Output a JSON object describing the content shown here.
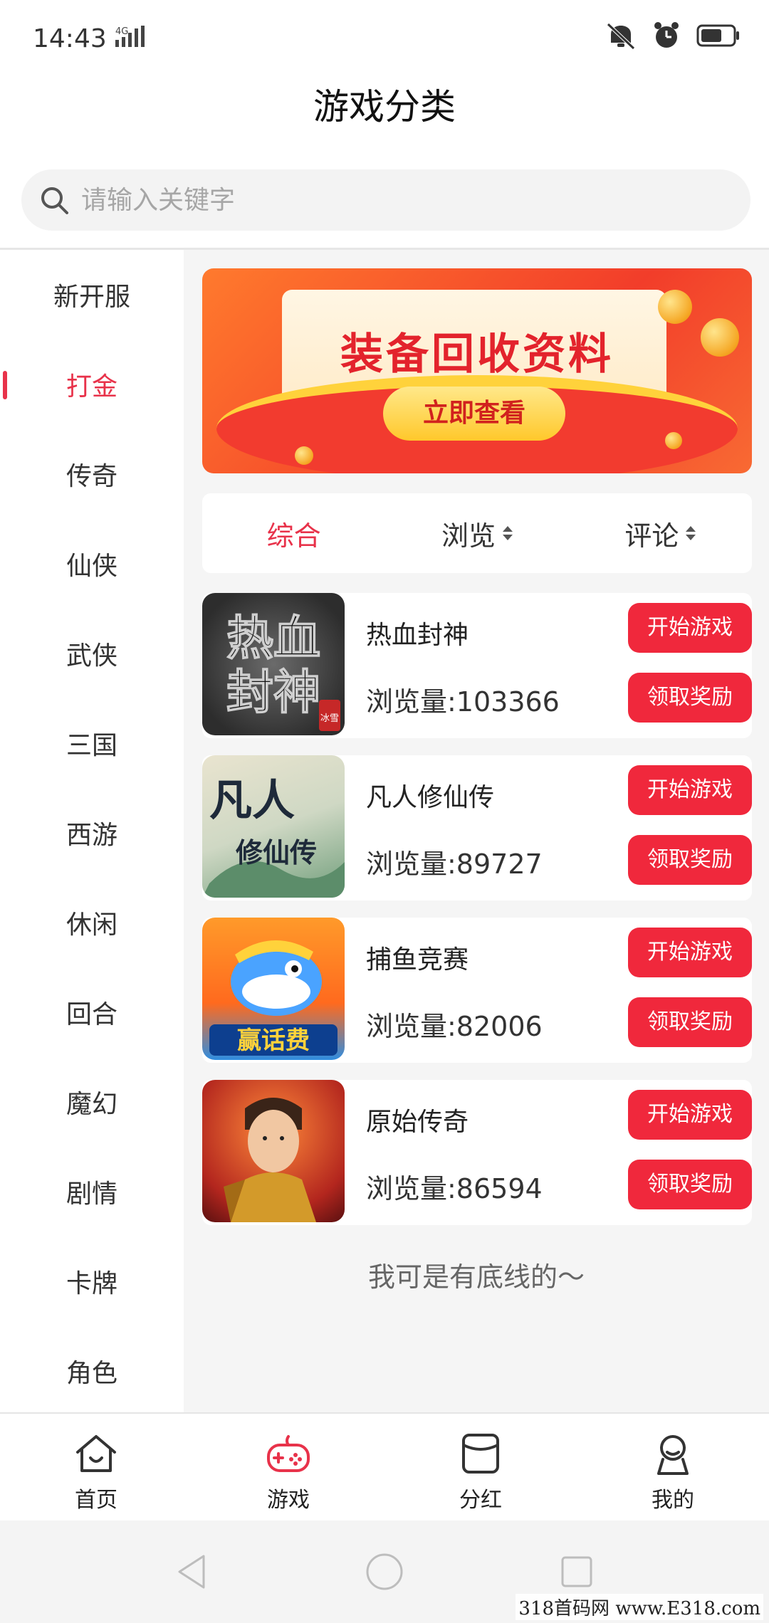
{
  "status_bar": {
    "time": "14:43",
    "network": "4G"
  },
  "header": {
    "title": "游戏分类"
  },
  "search": {
    "placeholder": "请输入关键字"
  },
  "sidebar": {
    "items": [
      {
        "label": "新开服",
        "active": false
      },
      {
        "label": "打金",
        "active": true
      },
      {
        "label": "传奇",
        "active": false
      },
      {
        "label": "仙侠",
        "active": false
      },
      {
        "label": "武侠",
        "active": false
      },
      {
        "label": "三国",
        "active": false
      },
      {
        "label": "西游",
        "active": false
      },
      {
        "label": "休闲",
        "active": false
      },
      {
        "label": "回合",
        "active": false
      },
      {
        "label": "魔幻",
        "active": false
      },
      {
        "label": "剧情",
        "active": false
      },
      {
        "label": "卡牌",
        "active": false
      },
      {
        "label": "角色",
        "active": false
      }
    ]
  },
  "banner": {
    "title": "装备回收资料",
    "button": "立即查看"
  },
  "sort": {
    "items": [
      "综合",
      "浏览",
      "评论"
    ]
  },
  "games": [
    {
      "name": "热血封神",
      "views": "浏览量:103366",
      "thumb_text_1": "热血",
      "thumb_text_2": "封神",
      "thumb_badge": "冰雪",
      "start_label": "开始游戏",
      "reward_label": "领取奖励"
    },
    {
      "name": "凡人修仙传",
      "views": "浏览量:89727",
      "thumb_text_1": "凡人",
      "thumb_text_2": "修仙传",
      "start_label": "开始游戏",
      "reward_label": "领取奖励"
    },
    {
      "name": "捕鱼竞赛",
      "views": "浏览量:82006",
      "thumb_text_1": "赢话费",
      "start_label": "开始游戏",
      "reward_label": "领取奖励"
    },
    {
      "name": "原始传奇",
      "views": "浏览量:86594",
      "start_label": "开始游戏",
      "reward_label": "领取奖励"
    }
  ],
  "list_end": "我可是有底线的～",
  "bottom_nav": {
    "items": [
      {
        "label": "首页",
        "icon": "home-icon"
      },
      {
        "label": "游戏",
        "icon": "gamepad-icon",
        "active": true
      },
      {
        "label": "分红",
        "icon": "bag-icon"
      },
      {
        "label": "我的",
        "icon": "user-icon"
      }
    ]
  },
  "watermark": "318首码网 www.E318.com",
  "colors": {
    "accent": "#e8324a",
    "button_red": "#f0283c"
  }
}
